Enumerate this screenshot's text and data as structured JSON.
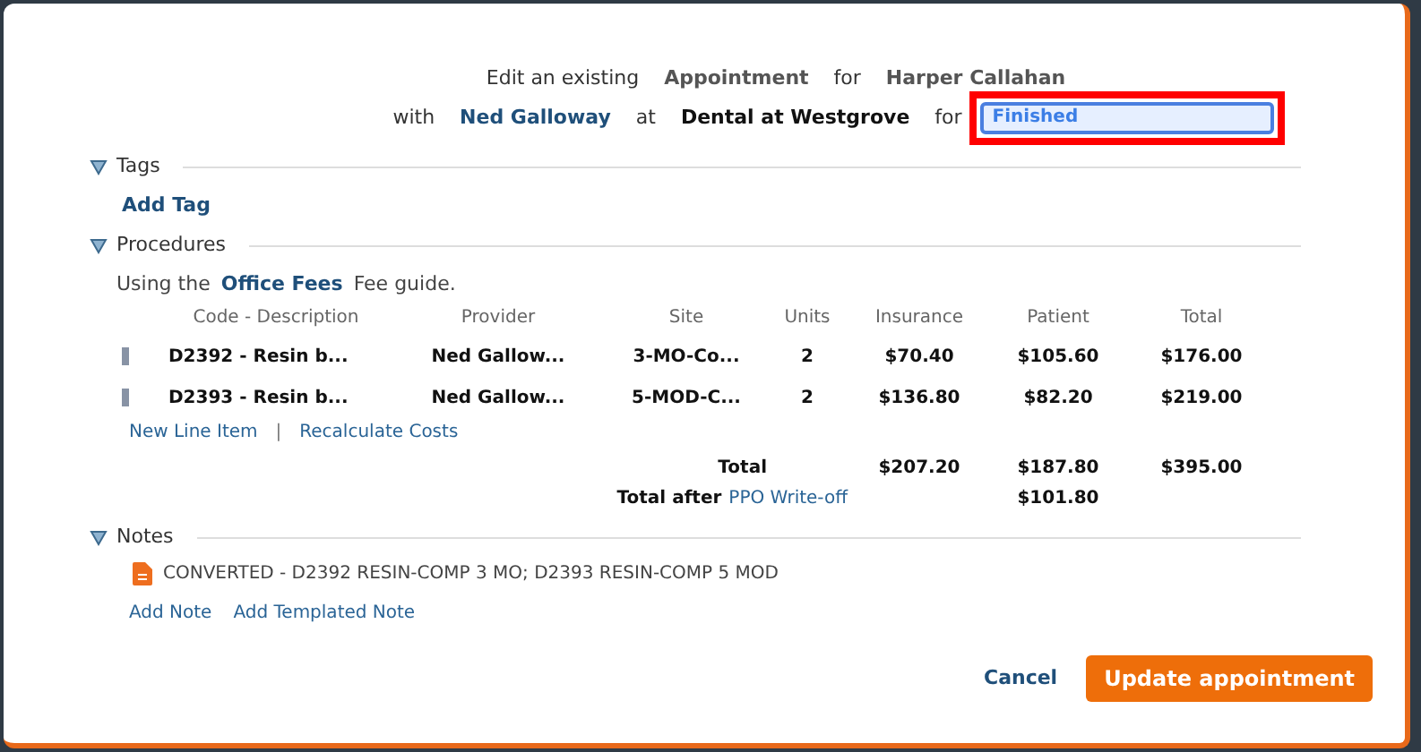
{
  "header": {
    "line1": [
      {
        "kind": "plain",
        "text": "Edit an existing"
      },
      {
        "kind": "strong",
        "text": "Appointment"
      },
      {
        "kind": "plain",
        "text": "for"
      },
      {
        "kind": "strong",
        "text": "Harper Callahan"
      }
    ],
    "line2": [
      {
        "kind": "plain",
        "text": "with"
      },
      {
        "kind": "link",
        "text": "Ned Galloway"
      },
      {
        "kind": "plain",
        "text": "at"
      },
      {
        "kind": "dark",
        "text": "Dental at Westgrove"
      },
      {
        "kind": "plain",
        "text": "for"
      }
    ],
    "status": {
      "value": "Finished",
      "highlighted": true
    }
  },
  "tags": {
    "title": "Tags",
    "expanded": true,
    "add_link": "Add Tag"
  },
  "procedures": {
    "title": "Procedures",
    "expanded": true,
    "fee_prefix": "Using the",
    "fee_guide": "Office Fees",
    "fee_suffix": "Fee guide.",
    "columns": [
      "Code - Description",
      "Provider",
      "Site",
      "Units",
      "Insurance",
      "Patient",
      "Total"
    ],
    "rows": [
      {
        "cells": [
          "D2392 - Resin b...",
          "Ned Gallow...",
          "3-MO-Co...",
          "2",
          "$70.40",
          "$105.60",
          "$176.00"
        ]
      },
      {
        "cells": [
          "D2393 - Resin b...",
          "Ned Gallow...",
          "5-MOD-C...",
          "2",
          "$136.80",
          "$82.20",
          "$219.00"
        ]
      }
    ],
    "actions": [
      "New Line Item",
      "Recalculate Costs"
    ],
    "action_separator": "|",
    "total_label": "Total",
    "totals": [
      "$207.20",
      "$187.80",
      "$395.00"
    ],
    "after_label": "Total after",
    "after_link": "PPO Write-off",
    "after_value": "$101.80"
  },
  "notes": {
    "title": "Notes",
    "expanded": true,
    "items": [
      "CONVERTED - D2392 RESIN-COMP 3 MO; D2393 RESIN-COMP 5 MOD"
    ],
    "actions": [
      "Add Note",
      "Add Templated Note"
    ]
  },
  "buttons": {
    "cancel": "Cancel",
    "submit": "Update appointment"
  }
}
